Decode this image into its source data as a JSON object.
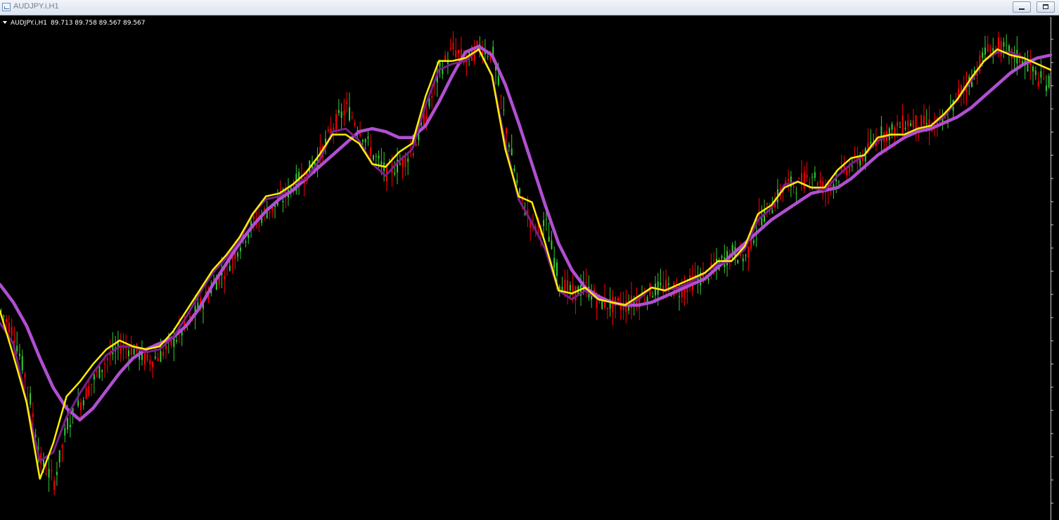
{
  "window": {
    "title": "AUDJPY.i,H1"
  },
  "info": {
    "symbol": "AUDJPY.i,H1",
    "ohlc": "89.713 89.758 89.567 89.567"
  },
  "colors": {
    "background": "#000000",
    "bull": "#33cc33",
    "bear": "#ff0000",
    "ma_fast": "#ffee00",
    "ma_mid": "#7a1f8c",
    "ma_slow": "#b04fd1",
    "price_line": "#8c8c8c"
  },
  "chart_data": {
    "type": "line",
    "instrument": "AUDJPY.i",
    "timeframe": "H1",
    "x_index": [
      0,
      5,
      10,
      15,
      20,
      25,
      30,
      35,
      40,
      45,
      50,
      55,
      60,
      65,
      70,
      75,
      80,
      85,
      90,
      95,
      100,
      105,
      110,
      115,
      120,
      125,
      130,
      135,
      140,
      145,
      150,
      155,
      160,
      165,
      170,
      175,
      180,
      185,
      190,
      195,
      200,
      205,
      210,
      215,
      220,
      225,
      230,
      235,
      240,
      245,
      250,
      255,
      260,
      265,
      270,
      275,
      280,
      285,
      290,
      295,
      300,
      305,
      310,
      315,
      320,
      325,
      330,
      335,
      340,
      345,
      350,
      355,
      360,
      365,
      370,
      375,
      380,
      385,
      390,
      395
    ],
    "price": [
      88.43,
      88.35,
      88.18,
      87.92,
      87.85,
      88.05,
      88.12,
      88.2,
      88.27,
      88.31,
      88.3,
      88.26,
      88.28,
      88.33,
      88.38,
      88.45,
      88.52,
      88.58,
      88.66,
      88.73,
      88.77,
      88.8,
      88.86,
      88.9,
      88.96,
      89.06,
      89.12,
      89.05,
      88.96,
      88.9,
      88.93,
      88.98,
      89.1,
      89.25,
      89.32,
      89.28,
      89.33,
      89.3,
      89.05,
      88.82,
      88.72,
      88.72,
      88.53,
      88.49,
      88.51,
      88.46,
      88.45,
      88.45,
      88.47,
      88.5,
      88.51,
      88.5,
      88.53,
      88.55,
      88.59,
      88.63,
      88.61,
      88.74,
      88.79,
      88.86,
      88.86,
      88.9,
      88.84,
      88.89,
      88.93,
      88.96,
      89.03,
      89.04,
      89.07,
      89.07,
      89.06,
      89.07,
      89.17,
      89.22,
      89.31,
      89.33,
      89.3,
      89.28,
      89.22,
      89.2
    ],
    "price_line": 89.567,
    "ylim": [
      87.72,
      89.43
    ],
    "grid": false,
    "candles_shown": 395,
    "series": [
      {
        "style": "yellow",
        "values": [
          88.43,
          88.28,
          88.12,
          87.86,
          87.98,
          88.14,
          88.19,
          88.25,
          88.3,
          88.33,
          88.31,
          88.3,
          88.31,
          88.36,
          88.43,
          88.5,
          88.57,
          88.62,
          88.68,
          88.76,
          88.82,
          88.83,
          88.86,
          88.9,
          88.96,
          89.03,
          89.03,
          89.0,
          88.93,
          88.92,
          88.97,
          89.0,
          89.16,
          89.28,
          89.28,
          89.29,
          89.32,
          89.23,
          88.98,
          88.82,
          88.8,
          88.66,
          88.5,
          88.49,
          88.51,
          88.47,
          88.46,
          88.45,
          88.48,
          88.51,
          88.5,
          88.52,
          88.54,
          88.56,
          88.6,
          88.6,
          88.65,
          88.76,
          88.79,
          88.85,
          88.87,
          88.85,
          88.85,
          88.91,
          88.95,
          88.96,
          89.02,
          89.03,
          89.03,
          89.05,
          89.06,
          89.1,
          89.15,
          89.22,
          89.28,
          89.32,
          89.3,
          89.29,
          89.27,
          89.25
        ]
      },
      {
        "style": "purple",
        "values": [
          88.39,
          88.32,
          88.12,
          87.92,
          87.95,
          88.07,
          88.15,
          88.22,
          88.28,
          88.31,
          88.31,
          88.29,
          88.3,
          88.34,
          88.41,
          88.49,
          88.56,
          88.61,
          88.67,
          88.76,
          88.81,
          88.82,
          88.86,
          88.88,
          88.94,
          89.04,
          89.05,
          89.01,
          88.93,
          88.89,
          88.94,
          88.98,
          89.13,
          89.25,
          89.27,
          89.28,
          89.32,
          89.23,
          89.0,
          88.81,
          88.73,
          88.64,
          88.5,
          88.47,
          88.5,
          88.47,
          88.46,
          88.45,
          88.47,
          88.51,
          88.5,
          88.51,
          88.53,
          88.56,
          88.59,
          88.6,
          88.64,
          88.74,
          88.78,
          88.86,
          88.87,
          88.85,
          88.84,
          88.89,
          88.93,
          88.96,
          89.01,
          89.03,
          89.03,
          89.05,
          89.06,
          89.09,
          89.15,
          89.21,
          89.28,
          89.31,
          89.31,
          89.29,
          89.27,
          89.25
        ]
      },
      {
        "style": "violet-thick",
        "values": [
          88.52,
          88.46,
          88.38,
          88.27,
          88.17,
          88.1,
          88.06,
          88.1,
          88.16,
          88.22,
          88.27,
          88.3,
          88.32,
          88.34,
          88.38,
          88.44,
          88.52,
          88.59,
          88.66,
          88.72,
          88.77,
          88.81,
          88.84,
          88.88,
          88.92,
          88.96,
          89.0,
          89.04,
          89.05,
          89.04,
          89.02,
          89.02,
          89.06,
          89.14,
          89.23,
          89.31,
          89.33,
          89.3,
          89.2,
          89.07,
          88.93,
          88.79,
          88.66,
          88.57,
          88.51,
          88.48,
          88.46,
          88.45,
          88.45,
          88.46,
          88.48,
          88.5,
          88.52,
          88.54,
          88.58,
          88.62,
          88.66,
          88.7,
          88.74,
          88.77,
          88.8,
          88.83,
          88.84,
          88.85,
          88.88,
          88.92,
          88.96,
          88.99,
          89.02,
          89.04,
          89.05,
          89.07,
          89.09,
          89.12,
          89.16,
          89.2,
          89.24,
          89.27,
          89.29,
          89.3
        ]
      }
    ]
  }
}
